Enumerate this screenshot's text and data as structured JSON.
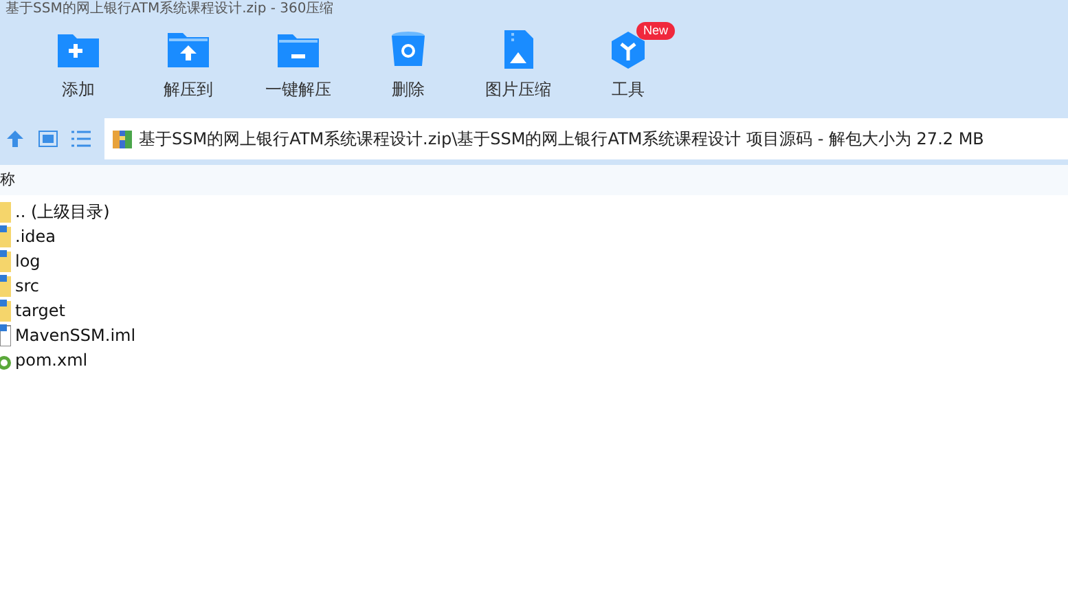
{
  "window": {
    "title": "基于SSM的网上银行ATM系统课程设计.zip - 360压缩"
  },
  "toolbar": [
    {
      "label": "添加",
      "kind": "add"
    },
    {
      "label": "解压到",
      "kind": "extract"
    },
    {
      "label": "一键解压",
      "kind": "oneclick"
    },
    {
      "label": "删除",
      "kind": "delete"
    },
    {
      "label": "图片压缩",
      "kind": "image"
    },
    {
      "label": "工具",
      "kind": "tools",
      "badge": "New"
    }
  ],
  "path": "基于SSM的网上银行ATM系统课程设计.zip\\基于SSM的网上银行ATM系统课程设计 项目源码 - 解包大小为 27.2 MB",
  "table": {
    "columns": [
      "称"
    ],
    "rows": [
      {
        "name": ".. (上级目录)",
        "kind": "parent"
      },
      {
        "name": ".idea",
        "kind": "folder"
      },
      {
        "name": "log",
        "kind": "folder"
      },
      {
        "name": "src",
        "kind": "folder"
      },
      {
        "name": "target",
        "kind": "folder"
      },
      {
        "name": "MavenSSM.iml",
        "kind": "file"
      },
      {
        "name": "pom.xml",
        "kind": "xml"
      }
    ]
  }
}
